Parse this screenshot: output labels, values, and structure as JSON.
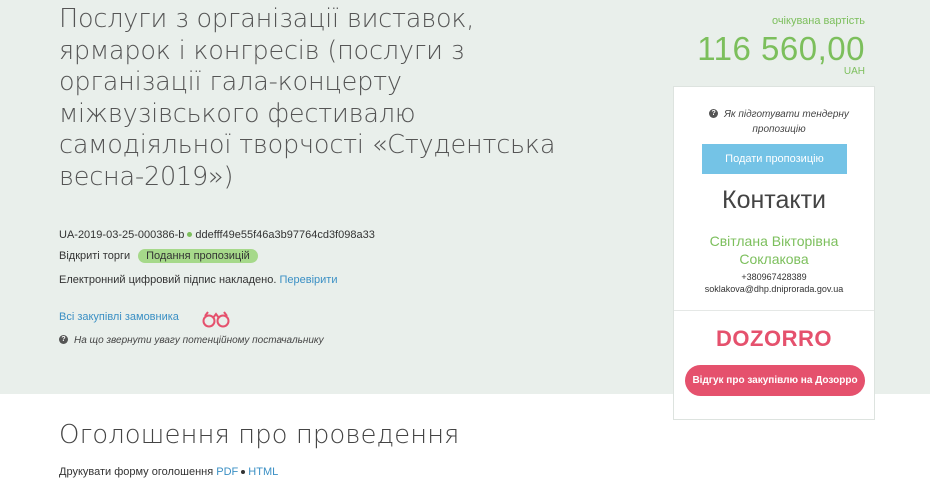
{
  "tender": {
    "title": "Послуги з організації виставок, ярмарок і конгресів (послуги з організації гала-концерту міжвузівського фестивалю самодіяльної творчості «Студентська весна-2019»)",
    "id": "UA-2019-03-25-000386-b",
    "hash": "ddefff49e55f46a3b97764cd3f098a33",
    "procedure": "Відкриті торги",
    "status": "Подання пропозицій",
    "signature_text": "Електронний цифровий підпис накладено.",
    "signature_link": "Перевірити",
    "all_purchases_link": "Всі закупівлі замовника",
    "hint": "На що звернути увагу потенційному постачальнику"
  },
  "price": {
    "label": "очікувана вартість",
    "amount": "116 560,00",
    "currency": "UAH"
  },
  "panel": {
    "how_to": "Як підготувати тендерну пропозицію",
    "submit_button": "Подати пропозицію",
    "contacts_title": "Контакти",
    "contact_name": "Світлана Вікторівна Соклакова",
    "phone": "+380967428389",
    "email": "soklakova@dhp.dniprorada.gov.ua",
    "dozorro_logo": "DOZORRO",
    "dozorro_button": "Відгук про закупівлю на Дозорро"
  },
  "announcement": {
    "title": "Оголошення про проведення",
    "print_label": "Друкувати форму оголошення",
    "pdf": "PDF",
    "html": "HTML"
  },
  "colors": {
    "background": "#e9efeb",
    "accent_green": "#7cbf5c",
    "link_blue": "#3a8fc4",
    "submit_blue": "#74c3e6",
    "dozorro_red": "#e5516d"
  },
  "icons": [
    "question-icon",
    "binoculars-icon"
  ]
}
